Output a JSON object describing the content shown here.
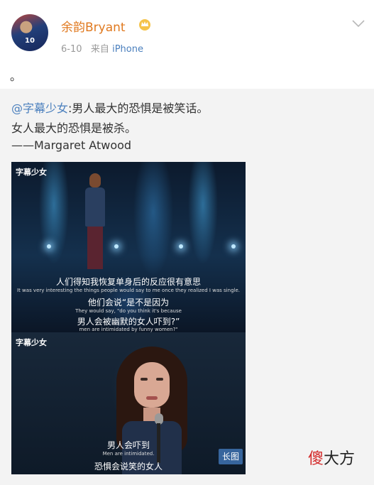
{
  "post": {
    "username": "余韵Bryant",
    "avatar_number": "10",
    "date": "6-10",
    "source_prefix": "来自",
    "source_name": "iPhone",
    "text": "。",
    "vip_icon": "crown-icon",
    "menu_icon": "chevron-down-icon"
  },
  "repost": {
    "mention": "@字幕少女",
    "line1_rest": ":男人最大的恐惧是被笑话。",
    "line2": "女人最大的恐惧是被杀。",
    "line3": "——Margaret Atwood",
    "image": {
      "watermark_top": "字幕少女",
      "watermark_bottom": "字幕少女",
      "subs": [
        {
          "cn": "人们得知我恢复单身后的反应很有意思",
          "en": "It was very interesting the things people would say to me once they realized I was single."
        },
        {
          "cn": "他们会说“是不是因为",
          "en": "They would say, \"do you think it's because"
        },
        {
          "cn": "男人会被幽默的女人吓到?”",
          "en": "men are intimidated by funny women?\""
        },
        {
          "cn": "男人会吓到",
          "en": "Men are intimidated."
        },
        {
          "cn": "恐惧会说笑的女人",
          "en": ""
        }
      ],
      "long_badge": "长图"
    }
  },
  "footer_watermark": {
    "red": "傻",
    "black": "大方"
  },
  "colors": {
    "username": "#e0791f",
    "link": "#4a7fbd",
    "repost_bg": "#f3f3f3",
    "meta": "#9a9a9a"
  }
}
